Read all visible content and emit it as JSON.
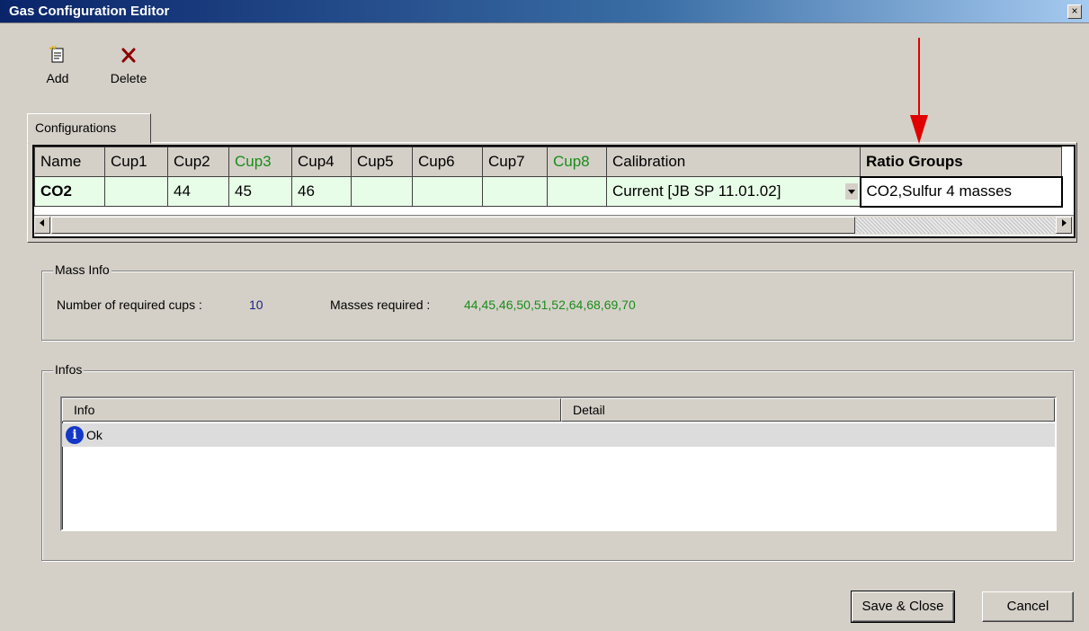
{
  "window": {
    "title": "Gas Configuration Editor",
    "close_glyph": "×"
  },
  "toolbar": {
    "add_label": "Add",
    "add_icon": "new-document-icon",
    "delete_label": "Delete",
    "delete_icon": "delete-x-icon",
    "delete_color": "#8b0000"
  },
  "tabs": [
    {
      "label": "Configurations"
    }
  ],
  "grid": {
    "columns": [
      "Name",
      "Cup1",
      "Cup2",
      "Cup3",
      "Cup4",
      "Cup5",
      "Cup6",
      "Cup7",
      "Cup8",
      "Calibration",
      "Ratio Groups"
    ],
    "rows": [
      {
        "Name": "CO2",
        "Cup1": "",
        "Cup2": "44",
        "Cup3": "45",
        "Cup4": "46",
        "Cup5": "",
        "Cup6": "",
        "Cup7": "",
        "Cup8": "",
        "Calibration": "Current [JB SP 11.01.02]",
        "Ratio Groups": "CO2,Sulfur 4 masses"
      }
    ],
    "highlight_columns": [
      "Cup3",
      "Cup8"
    ],
    "highlight_color": "#1a8c1a",
    "row_bg": "#e8fde8"
  },
  "mass_info": {
    "legend": "Mass Info",
    "required_cups_label": "Number of required cups :",
    "required_cups_value": "10",
    "masses_label": "Masses required :",
    "masses_value": "44,45,46,50,51,52,64,68,69,70"
  },
  "infos": {
    "legend": "Infos",
    "columns": [
      "Info",
      "Detail"
    ],
    "rows": [
      {
        "icon": "info-icon",
        "info": "Ok",
        "detail": ""
      }
    ]
  },
  "buttons": {
    "save_close": "Save & Close",
    "cancel": "Cancel"
  },
  "annotation": {
    "arrow_color": "#e00000"
  }
}
